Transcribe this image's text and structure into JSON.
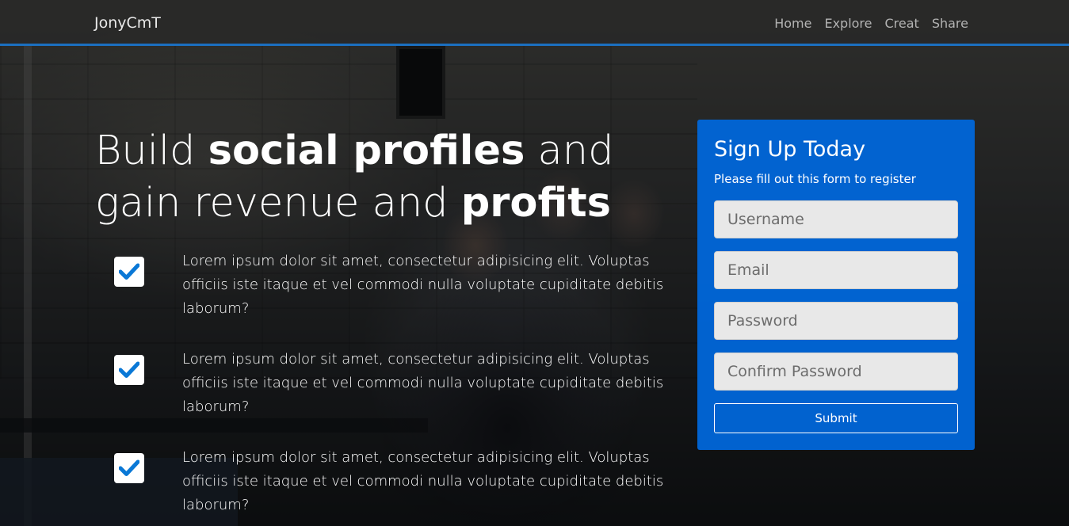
{
  "navbar": {
    "brand": "JonyCmT",
    "links": [
      "Home",
      "Explore",
      "Creat",
      "Share"
    ]
  },
  "hero": {
    "headline_parts": [
      {
        "text": "Build ",
        "bold": false
      },
      {
        "text": "social profiles",
        "bold": true
      },
      {
        "text": " and gain revenue and ",
        "bold": false
      },
      {
        "text": "profits",
        "bold": true
      }
    ]
  },
  "features": [
    {
      "icon": "check-icon",
      "text": "Lorem ipsum dolor sit amet, consectetur adipisicing elit. Voluptas officiis iste itaque et vel commodi nulla voluptate cupiditate debitis laborum?"
    },
    {
      "icon": "check-icon",
      "text": "Lorem ipsum dolor sit amet, consectetur adipisicing elit. Voluptas officiis iste itaque et vel commodi nulla voluptate cupiditate debitis laborum?"
    },
    {
      "icon": "check-icon",
      "text": "Lorem ipsum dolor sit amet, consectetur adipisicing elit. Voluptas officiis iste itaque et vel commodi nulla voluptate cupiditate debitis laborum?"
    }
  ],
  "signup": {
    "title": "Sign Up Today",
    "subtitle": "Please fill out this form to register",
    "fields": {
      "username": {
        "placeholder": "Username",
        "value": ""
      },
      "email": {
        "placeholder": "Email",
        "value": ""
      },
      "password": {
        "placeholder": "Password",
        "value": ""
      },
      "confirm_password": {
        "placeholder": "Confirm Password",
        "value": ""
      }
    },
    "submit_label": "Submit"
  },
  "colors": {
    "accent": "#1b6fc0",
    "card": "#0068de",
    "check": "#0a78d6"
  }
}
